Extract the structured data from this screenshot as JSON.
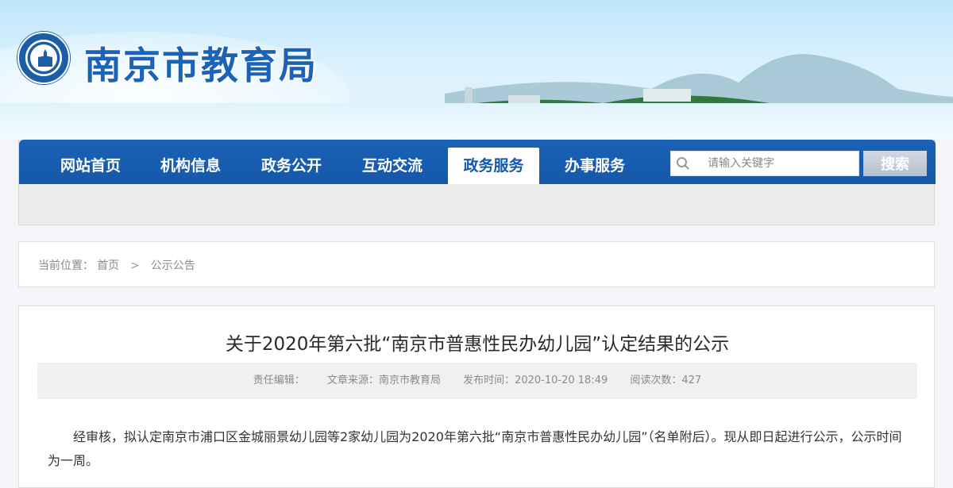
{
  "site": {
    "title": "南京市教育局"
  },
  "nav": {
    "items": [
      {
        "label": "网站首页"
      },
      {
        "label": "机构信息"
      },
      {
        "label": "政务公开"
      },
      {
        "label": "互动交流"
      },
      {
        "label": "政务服务"
      },
      {
        "label": "办事服务"
      }
    ],
    "active_index": 4
  },
  "search": {
    "placeholder": "请输入关键字",
    "button_label": "搜索"
  },
  "breadcrumb": {
    "prefix": "当前位置：",
    "items": [
      {
        "label": "首页"
      },
      {
        "label": "公示公告"
      }
    ],
    "separator": ">"
  },
  "article": {
    "title": "关于2020年第六批“南京市普惠性民办幼儿园”认定结果的公示",
    "meta": {
      "editor": "责任编辑：",
      "source": "文章来源：南京市教育局",
      "published": "发布时间：2020-10-20 18:49",
      "views": "阅读次数：427"
    },
    "body": "经审核，拟认定南京市浦口区金城丽景幼儿园等2家幼儿园为2020年第六批“南京市普惠性民办幼儿园”（名单附后）。现从即日起进行公示，公示时间为一周。"
  },
  "colors": {
    "nav_blue": "#1558a9",
    "title_blue": "#1b63b8",
    "search_button": "#b6c1cf"
  },
  "icons": {
    "search": "search-icon",
    "logo": "emblem-logo"
  }
}
